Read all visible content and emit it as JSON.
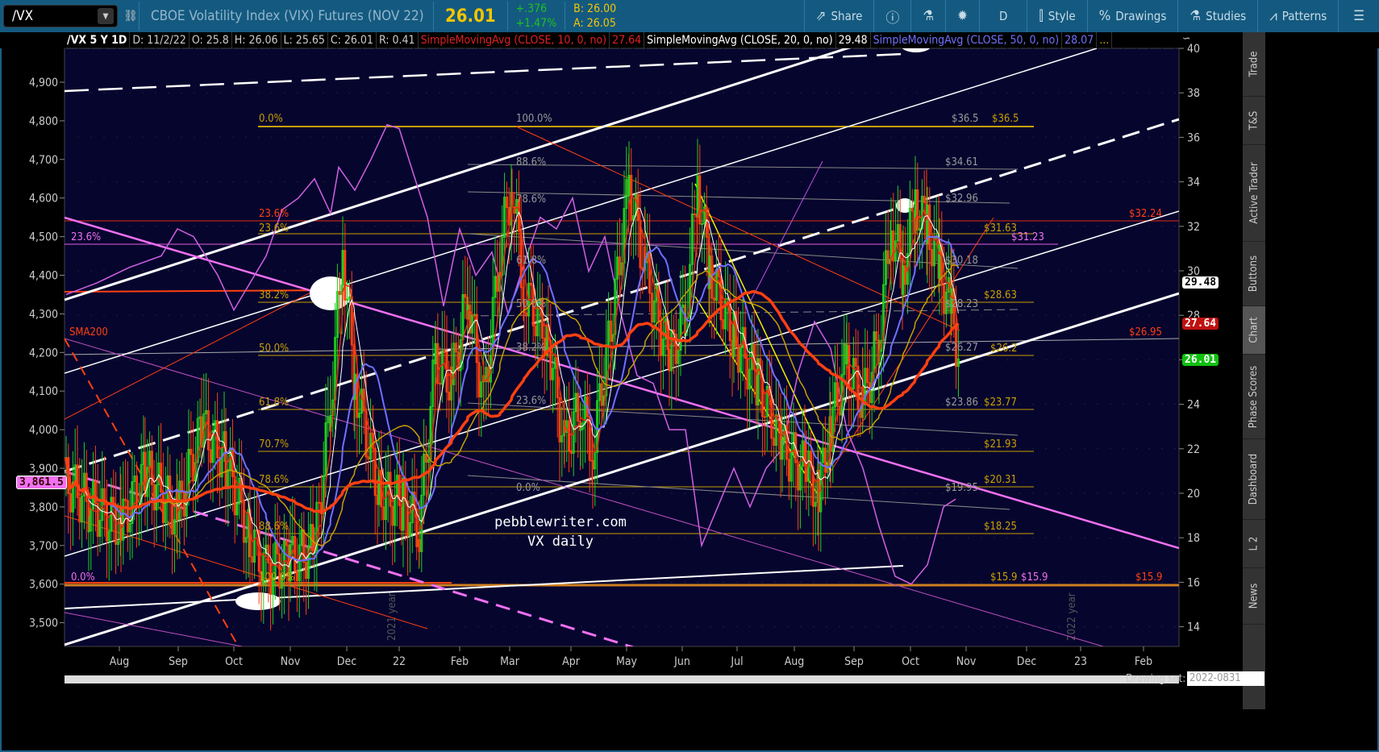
{
  "toolbar": {
    "symbol": "/VX",
    "description": "CBOE Volatility Index (VIX) Futures (NOV 22)",
    "last": "26.01",
    "change": "+.376",
    "change_pct": "+1.47%",
    "bid": "B: 26.00",
    "ask": "A: 26.05",
    "buttons": [
      {
        "label": "Share",
        "icon": "share-icon"
      },
      {
        "label": "",
        "icon": "info-icon"
      },
      {
        "label": "",
        "icon": "flask-icon"
      },
      {
        "label": "",
        "icon": "gear-icon"
      },
      {
        "label": "D",
        "icon": ""
      },
      {
        "label": "Style",
        "icon": "candle-icon"
      },
      {
        "label": "Drawings",
        "icon": "percent-icon"
      },
      {
        "label": "Studies",
        "icon": "flask-icon"
      },
      {
        "label": "Patterns",
        "icon": "pattern-icon"
      }
    ]
  },
  "infobar": {
    "period": "/VX 5 Y 1D",
    "date": "D: 11/2/22",
    "open": "O: 25.8",
    "high": "H: 26.06",
    "low": "L: 25.65",
    "close": "C: 26.01",
    "range": "R: 0.41",
    "sma10": "SimpleMovingAvg (CLOSE, 10, 0, no)",
    "sma10_val": "27.64",
    "sma20": "SimpleMovingAvg (CLOSE, 20, 0, no)",
    "sma20_val": "29.48",
    "sma50": "SimpleMovingAvg (CLOSE, 50, 0, no)",
    "sma50_val": "28.07",
    "more": "..."
  },
  "left_axis": [
    "4,900",
    "4,800",
    "4,700",
    "4,600",
    "4,500",
    "4,400",
    "4,300",
    "4,200",
    "4,100",
    "4,000",
    "3,900",
    "3,800",
    "3,700",
    "3,600",
    "3,500"
  ],
  "left_badge": "3,861.5",
  "right_axis": [
    "40",
    "38",
    "36",
    "34",
    "32",
    "30",
    "28",
    "26",
    "24",
    "22",
    "20",
    "18",
    "16",
    "14"
  ],
  "right_badges": {
    "sma20": "29.48",
    "sma10": "27.64",
    "last": "26.01"
  },
  "x_axis": [
    "Aug",
    "Sep",
    "Oct",
    "Nov",
    "Dec",
    "22",
    "Feb",
    "Mar",
    "Apr",
    "May",
    "Jun",
    "Jul",
    "Aug",
    "Sep",
    "Oct",
    "Nov",
    "Dec",
    "23",
    "Feb"
  ],
  "year_marks": [
    "2021 year",
    "2022 year"
  ],
  "fib1": [
    "0.0%",
    "23.6%",
    "38.2%",
    "50.0%",
    "61.8%",
    "70.7%",
    "78.6%",
    "88.6%",
    "100.0%"
  ],
  "fib2": [
    "100.0%",
    "88.6%",
    "78.6%",
    "61.8%",
    "50.0%",
    "38.2%",
    "23.6%",
    "0.0%"
  ],
  "fib_misc": {
    "pink_23": "23.6%",
    "pink_0": "0.0%",
    "red_23": "23.6%",
    "sma200": "SMA200"
  },
  "price_labels": {
    "gray": [
      "$36.5",
      "$34.61",
      "$32.96",
      "$30.18",
      "$28.23",
      "$26.27",
      "$23.86",
      "$19.95"
    ],
    "gold": [
      "$36.5",
      "$31.63",
      "$28.63",
      "$26.2",
      "$23.77",
      "$21.93",
      "$20.31",
      "$18.25",
      "$15.9"
    ],
    "red": [
      "$32.24",
      "$26.95",
      "$15.9"
    ],
    "pink": [
      "$31.23",
      "$15.9"
    ]
  },
  "watermark": {
    "line1": "pebblewriter.com",
    "line2": "VX daily"
  },
  "side_tabs": [
    "Trade",
    "T&S",
    "Active Trader",
    "Buttons",
    "Chart",
    "Phase Scores",
    "Dashboard",
    "L 2",
    "News"
  ],
  "drawing_set": {
    "label": "Drawing set:",
    "value": "2022-0831"
  }
}
